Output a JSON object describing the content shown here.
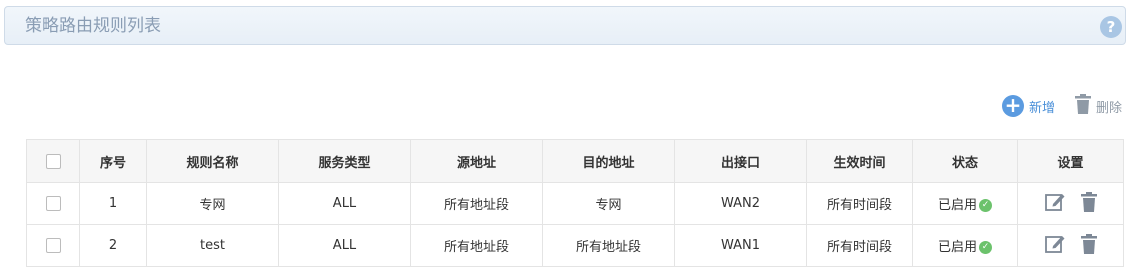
{
  "header": {
    "title": "策略路由规则列表",
    "help_icon": "question-icon"
  },
  "toolbar": {
    "add_label": "新增",
    "delete_label": "删除",
    "add_icon": "plus-circle-icon",
    "delete_icon": "trash-icon"
  },
  "table": {
    "columns": [
      "序号",
      "规则名称",
      "服务类型",
      "源地址",
      "目的地址",
      "出接口",
      "生效时间",
      "状态",
      "设置"
    ],
    "rows": [
      {
        "index": "1",
        "name": "专网",
        "service": "ALL",
        "src": "所有地址段",
        "dst": "专网",
        "iface": "WAN2",
        "time": "所有时间段",
        "status": "已启用"
      },
      {
        "index": "2",
        "name": "test",
        "service": "ALL",
        "src": "所有地址段",
        "dst": "所有地址段",
        "iface": "WAN1",
        "time": "所有时间段",
        "status": "已启用"
      }
    ]
  },
  "colors": {
    "accent": "#4a8fd8",
    "status_ok": "#6cc26c",
    "icon_gray": "#7d8896",
    "title_text": "#8a9db4"
  }
}
